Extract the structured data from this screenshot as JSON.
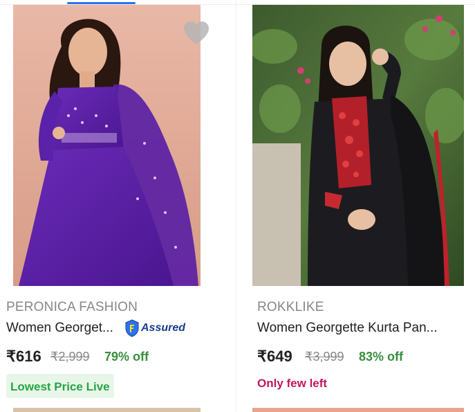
{
  "products": [
    {
      "brand": "PERONICA FASHION",
      "title": "Women Georget...",
      "assured_label": "Assured",
      "price": "₹616",
      "mrp": "₹2,999",
      "discount": "79% off",
      "tag": "Lowest Price Live",
      "image_alt": "Woman in purple georgette anarkali with dupatta",
      "icon": "heart-icon"
    },
    {
      "brand": "ROKKLIKE",
      "title": "Women Georgette Kurta Pan...",
      "price": "₹649",
      "mrp": "₹3,999",
      "discount": "83% off",
      "tag": "Only few left",
      "image_alt": "Woman in black kurta with red embroidery"
    }
  ],
  "colors": {
    "accent": "#2874f0",
    "discount": "#388e3c",
    "lowest_price_bg": "#e8f6e9",
    "lowest_price_text": "#26a541",
    "few_left": "#c2185b",
    "assured": "#1a3d8f"
  }
}
